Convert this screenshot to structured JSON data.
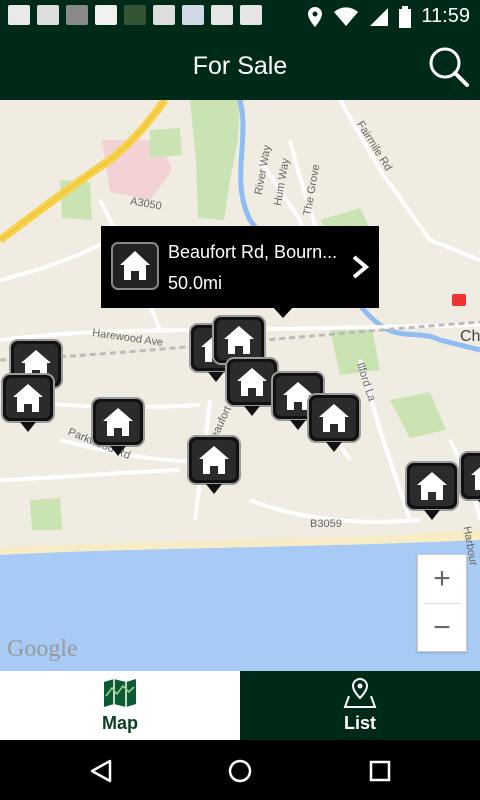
{
  "status_bar": {
    "time": "11:59",
    "notification_icons": [
      "brand-icon",
      "image-icon",
      "magazine-icon",
      "brand-icon",
      "app-icon",
      "download-icon",
      "focus-app-icon",
      "briefcase-icon",
      "briefcase-icon"
    ],
    "right_icons": [
      "location-icon",
      "wifi-icon",
      "signal-icon",
      "battery-icon"
    ]
  },
  "app_bar": {
    "title": "For Sale",
    "search_icon": "search-icon"
  },
  "map": {
    "street_labels": [
      "A3050",
      "Harewood Ave",
      "Parkwood Rd",
      "Beaufort Rd",
      "River Way",
      "Hum Way",
      "The Grove",
      "Fairmile Rd",
      "Ilford La",
      "B3059",
      "Harbour",
      "Ch"
    ],
    "callout": {
      "address": "Beaufort Rd, Bourn...",
      "distance": "50.0mi"
    },
    "zoom_in": "+",
    "zoom_out": "−",
    "attribution": "Google",
    "pin_icon": "house-pin-icon",
    "pin_count": 11
  },
  "tabs": [
    {
      "label": "Map",
      "icon": "map-icon",
      "active": true
    },
    {
      "label": "List",
      "icon": "list-location-icon",
      "active": false
    }
  ],
  "nav_bar": {
    "buttons": [
      "back-icon",
      "home-icon",
      "recents-icon"
    ]
  },
  "colors": {
    "brand_dark_green": "#002a18",
    "map_land": "#f1ece2",
    "map_water": "#a8cbf6",
    "map_park": "#c9e3b3",
    "major_road": "#f7d14a"
  }
}
